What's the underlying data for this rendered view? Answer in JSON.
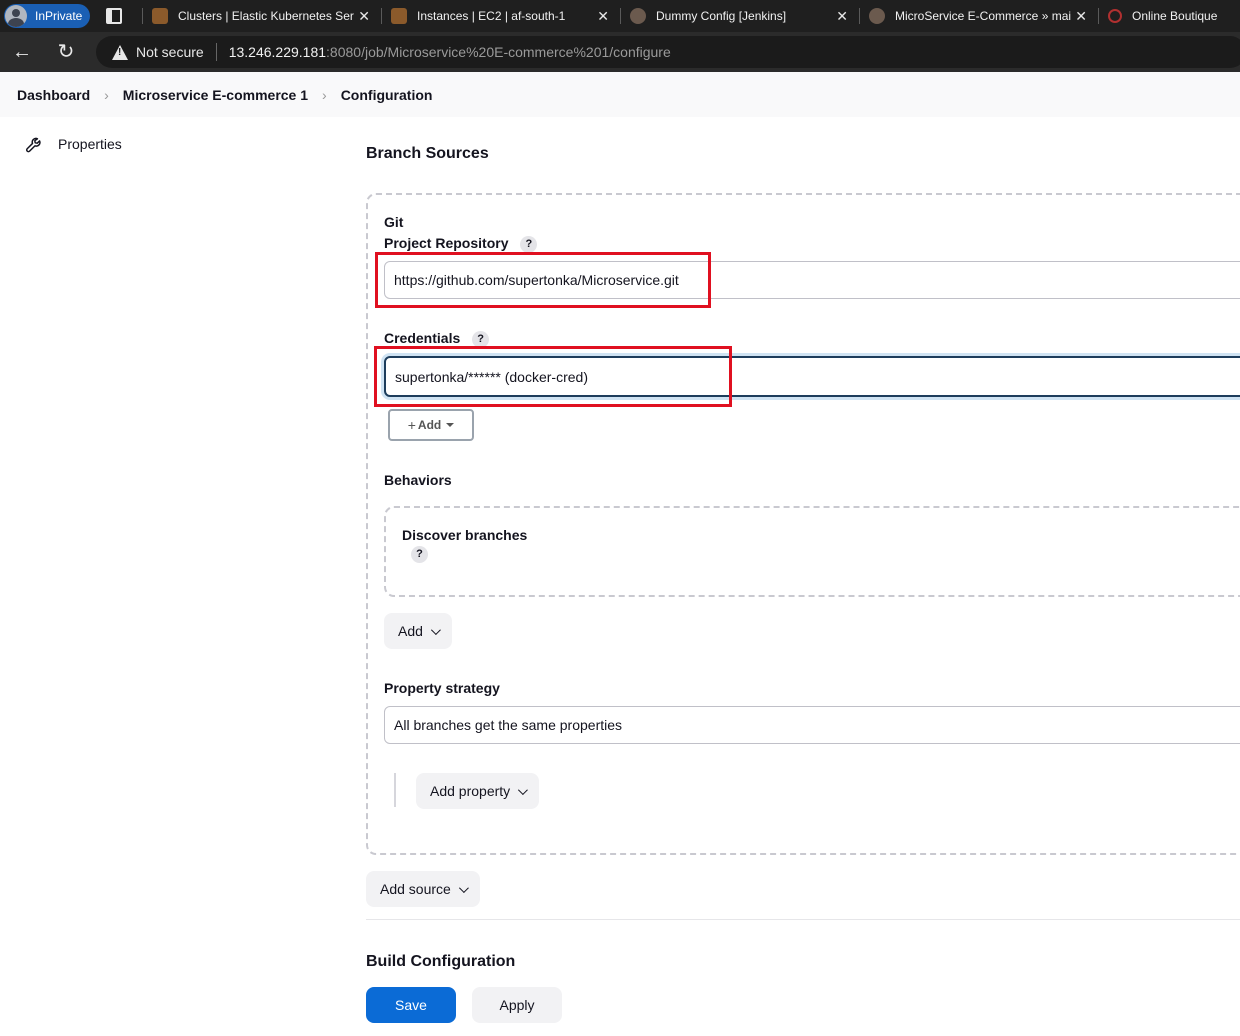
{
  "browser": {
    "profile_label": "InPrivate",
    "tabs": [
      {
        "title": "Clusters | Elastic Kubernetes Serv",
        "favicon_color": "#8b5a2b"
      },
      {
        "title": "Instances | EC2 | af-south-1",
        "favicon_color": "#8b5a2b"
      },
      {
        "title": "Dummy Config [Jenkins]",
        "favicon_color": "#6b5a4e"
      },
      {
        "title": "MicroService E-Commerce » mai",
        "favicon_color": "#6b5a4e"
      },
      {
        "title": "Online Boutique",
        "favicon_color": "#b03030"
      }
    ],
    "security_label": "Not secure",
    "url_host": "13.246.229.181",
    "url_path": ":8080/job/Microservice%20E-commerce%201/configure"
  },
  "breadcrumbs": [
    "Dashboard",
    "Microservice E-commerce 1",
    "Configuration"
  ],
  "sidebar": {
    "items": [
      {
        "label": "Properties",
        "icon": "wrench-icon"
      }
    ]
  },
  "branch_sources": {
    "title": "Branch Sources",
    "git_label": "Git",
    "project_repo_label": "Project Repository",
    "project_repo_value": "https://github.com/supertonka/Microservice.git",
    "credentials_label": "Credentials",
    "credentials_value": "supertonka/****** (docker-cred)",
    "add_cred_label": "Add",
    "behaviors_label": "Behaviors",
    "discover_branches_label": "Discover branches",
    "add_behavior_label": "Add",
    "property_strategy_label": "Property strategy",
    "property_strategy_value": "All branches get the same properties",
    "add_property_label": "Add property",
    "add_source_label": "Add source",
    "help_glyph": "?"
  },
  "build_configuration": {
    "title": "Build Configuration"
  },
  "footer": {
    "save_label": "Save",
    "apply_label": "Apply"
  },
  "colors": {
    "primary": "#0b6bd6",
    "highlight_box": "#e01020"
  }
}
